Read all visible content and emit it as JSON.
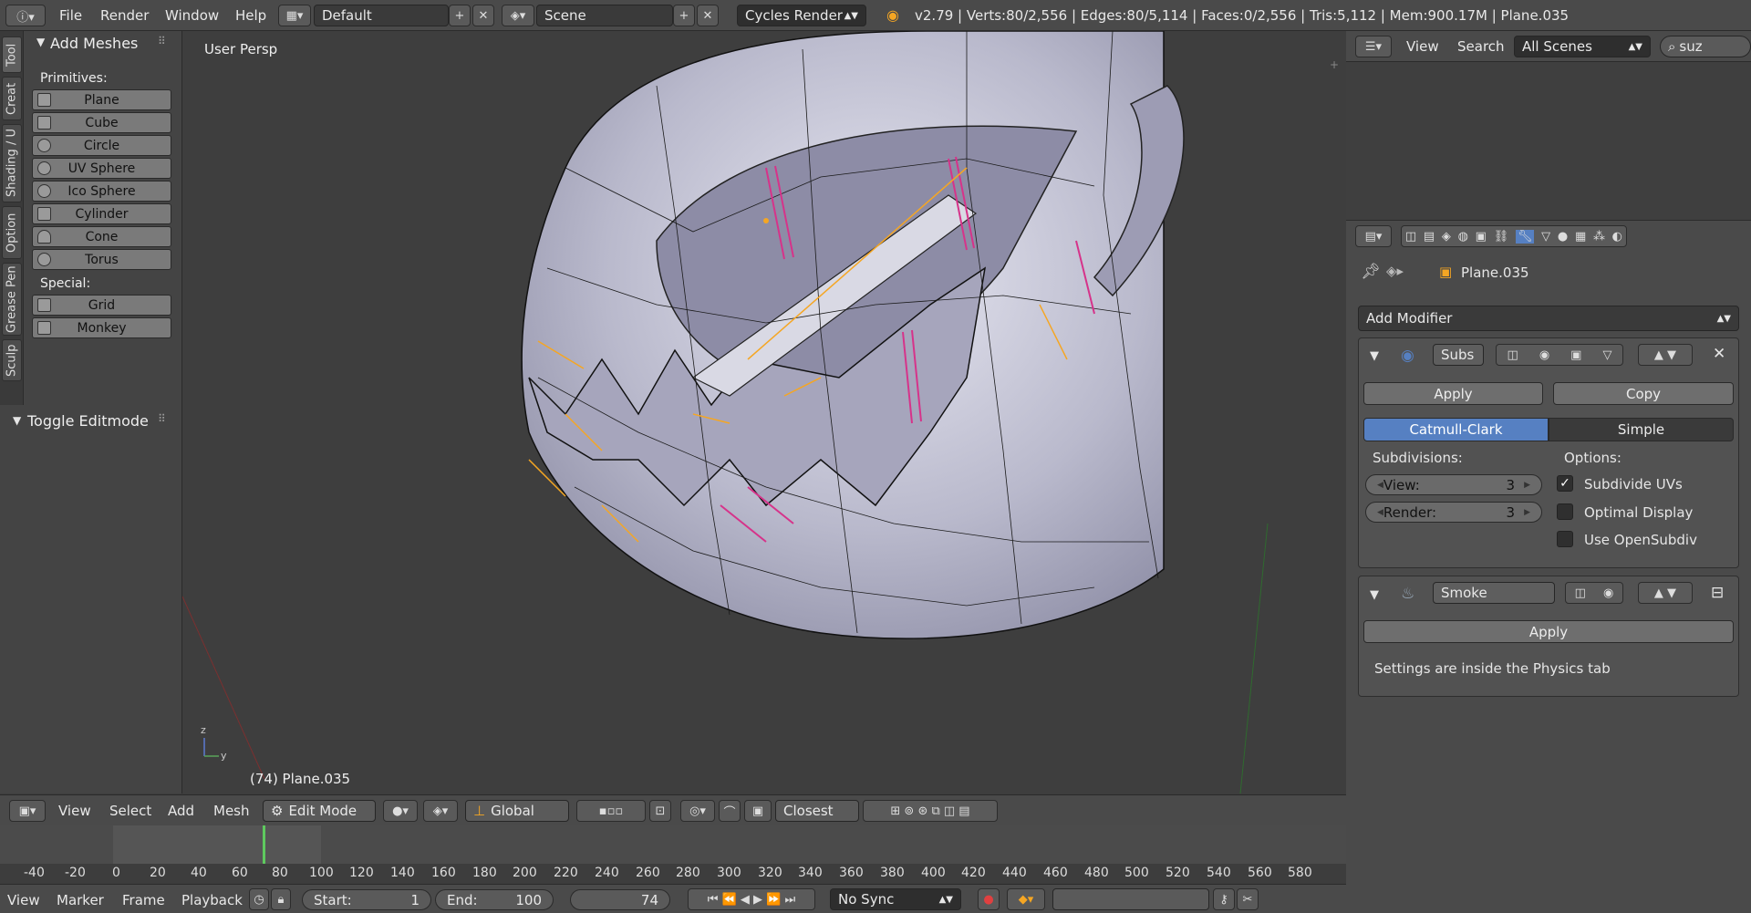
{
  "topbar": {
    "menus": [
      "File",
      "Render",
      "Window",
      "Help"
    ],
    "layout": "Default",
    "scene": "Scene",
    "engine": "Cycles Render",
    "stats": "v2.79 | Verts:80/2,556 | Edges:80/5,114 | Faces:0/2,556 | Tris:5,112 | Mem:900.17M | Plane.035"
  },
  "toolshelf": {
    "tabs": [
      "Tool",
      "Creat",
      "Shading / U",
      "Option",
      "Grease Pen",
      "Sculp"
    ],
    "panel_title": "Add Meshes",
    "primitives_label": "Primitives:",
    "primitives": [
      "Plane",
      "Cube",
      "Circle",
      "UV Sphere",
      "Ico Sphere",
      "Cylinder",
      "Cone",
      "Torus"
    ],
    "special_label": "Special:",
    "special": [
      "Grid",
      "Monkey"
    ],
    "toggle_panel": "Toggle Editmode"
  },
  "viewport": {
    "view_name": "User Persp",
    "object_label": "(74) Plane.035"
  },
  "vp_header": {
    "menus": [
      "View",
      "Select",
      "Add",
      "Mesh"
    ],
    "mode": "Edit Mode",
    "orientation": "Global",
    "snap": "Closest"
  },
  "timeline": {
    "ticks": [
      "-40",
      "-20",
      "0",
      "20",
      "40",
      "60",
      "80",
      "100",
      "120",
      "140",
      "160",
      "180",
      "200",
      "220",
      "240",
      "260",
      "280",
      "300",
      "320",
      "340",
      "360",
      "380",
      "400",
      "420",
      "440",
      "460",
      "480",
      "500",
      "520",
      "540",
      "560",
      "580"
    ],
    "menus": [
      "View",
      "Marker",
      "Frame",
      "Playback"
    ],
    "start_label": "Start:",
    "start": "1",
    "end_label": "End:",
    "end": "100",
    "current": "74",
    "sync": "No Sync"
  },
  "outliner": {
    "menus": [
      "View",
      "Search"
    ],
    "filter": "All Scenes",
    "search": "suz"
  },
  "properties": {
    "object_name": "Plane.035",
    "add_modifier": "Add Modifier",
    "subsurf": {
      "name": "Subs",
      "apply": "Apply",
      "copy": "Copy",
      "mode_active": "Catmull-Clark",
      "mode_other": "Simple",
      "subdivisions_label": "Subdivisions:",
      "view_label": "View:",
      "view_value": "3",
      "render_label": "Render:",
      "render_value": "3",
      "options_label": "Options:",
      "opt1": "Subdivide UVs",
      "opt2": "Optimal Display",
      "opt3": "Use OpenSubdiv"
    },
    "smoke": {
      "name": "Smoke",
      "apply": "Apply",
      "note": "Settings are inside the Physics tab"
    }
  },
  "colors": {
    "accent": "#5680c2",
    "selection": "#f5a623",
    "seam": "#d6338a"
  }
}
